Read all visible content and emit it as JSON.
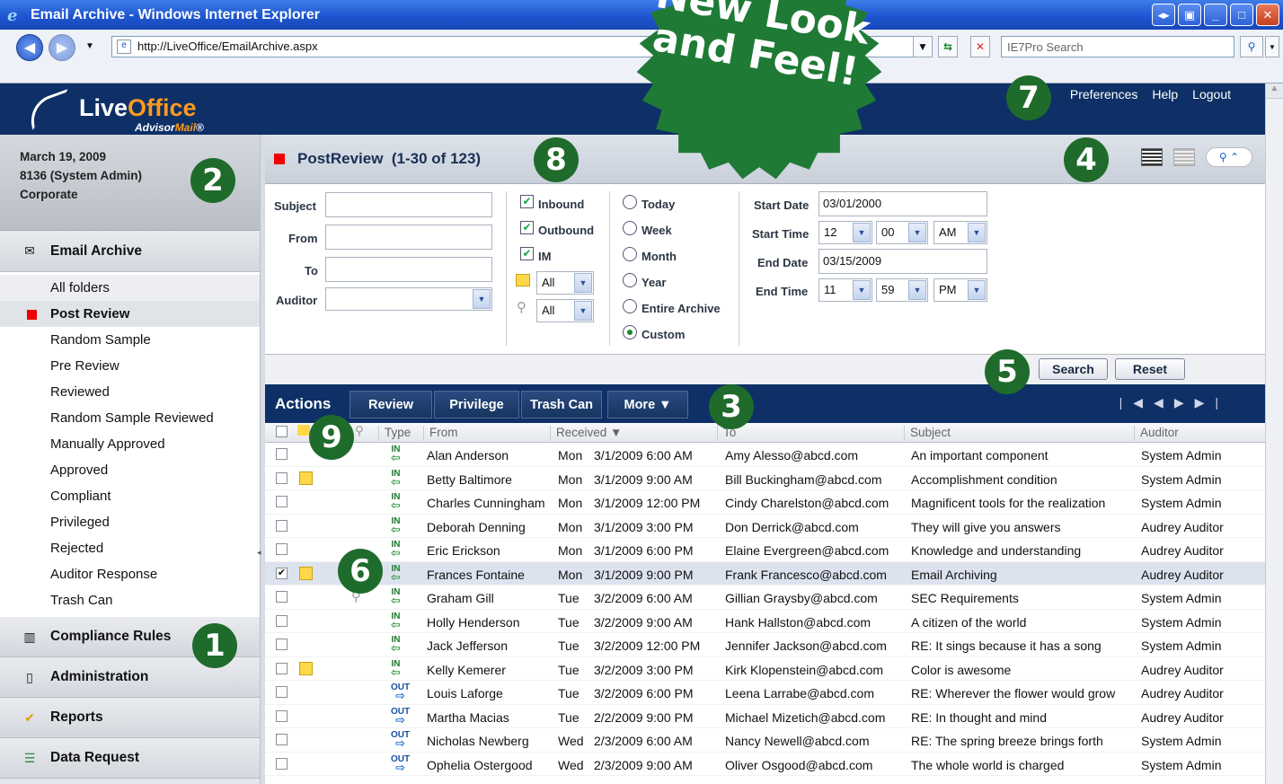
{
  "window": {
    "title": "Email Archive - Windows Internet Explorer"
  },
  "browser": {
    "url": "http://LiveOffice/EmailArchive.aspx",
    "search_placeholder": "IE7Pro Search"
  },
  "brand": {
    "name_a": "Live",
    "name_b": "Office",
    "sub_a": "Advisor",
    "sub_b": "Mail",
    "sub_c": "®"
  },
  "toplinks": [
    "Preferences",
    "Help",
    "Logout"
  ],
  "user": {
    "date": "March 19, 2009",
    "account": "8136 (System Admin)",
    "org": "Corporate"
  },
  "nav": {
    "email_archive": "Email Archive",
    "folders": [
      "All folders",
      "Post Review",
      "Random Sample",
      "Pre Review",
      "Reviewed",
      "Random Sample Reviewed",
      "Manually Approved",
      "Approved",
      "Compliant",
      "Privileged",
      "Rejected",
      "Auditor Response",
      "Trash Can"
    ],
    "bottom": [
      "Compliance Rules",
      "Administration",
      "Reports",
      "Data Request"
    ]
  },
  "page": {
    "title": "PostReview",
    "count": "(1-30 of 123)"
  },
  "filters": {
    "subject_label": "Subject",
    "from_label": "From",
    "to_label": "To",
    "auditor_label": "Auditor",
    "inbound": "Inbound",
    "outbound": "Outbound",
    "im": "IM",
    "flag_all": "All",
    "attach_all": "All",
    "radios": [
      "Today",
      "Week",
      "Month",
      "Year",
      "Entire Archive",
      "Custom"
    ],
    "start_date_label": "Start Date",
    "start_date": "03/01/2000",
    "start_time_label": "Start Time",
    "start_hour": "12",
    "start_min": "00",
    "start_ampm": "AM",
    "end_date_label": "End Date",
    "end_date": "03/15/2009",
    "end_time_label": "End Time",
    "end_hour": "11",
    "end_min": "59",
    "end_ampm": "PM"
  },
  "buttons": {
    "search": "Search",
    "reset": "Reset"
  },
  "actions": {
    "title": "Actions",
    "review": "Review",
    "privilege": "Privilege",
    "trash": "Trash Can",
    "more": "More  ▼"
  },
  "grid": {
    "headers": {
      "type": "Type",
      "from": "From",
      "received": "Received ▼",
      "to": "To",
      "subject": "Subject",
      "auditor": "Auditor"
    },
    "rows": [
      {
        "day": "Mon",
        "date": "3/1/2009 6:00 AM",
        "from": "Alan Anderson",
        "to": "Amy Alesso@abcd.com",
        "subject": "An important component",
        "auditor": "System Admin",
        "dir": "IN"
      },
      {
        "day": "Mon",
        "date": "3/1/2009 9:00 AM",
        "from": "Betty Baltimore",
        "to": "Bill Buckingham@abcd.com",
        "subject": "Accomplishment condition",
        "auditor": "System Admin",
        "dir": "IN"
      },
      {
        "day": "Mon",
        "date": "3/1/2009 12:00 PM",
        "from": "Charles Cunningham",
        "to": "Cindy Charelston@abcd.com",
        "subject": "Magnificent tools for the realization",
        "auditor": "System Admin",
        "dir": "IN"
      },
      {
        "day": "Mon",
        "date": "3/1/2009 3:00 PM",
        "from": "Deborah Denning",
        "to": "Don Derrick@abcd.com",
        "subject": "They will give you answers",
        "auditor": "Audrey Auditor",
        "dir": "IN"
      },
      {
        "day": "Mon",
        "date": "3/1/2009 6:00 PM",
        "from": "Eric Erickson",
        "to": "Elaine Evergreen@abcd.com",
        "subject": "Knowledge and understanding",
        "auditor": "Audrey Auditor",
        "dir": "IN"
      },
      {
        "day": "Mon",
        "date": "3/1/2009 9:00 PM",
        "from": "Frances Fontaine",
        "to": "Frank Francesco@abcd.com",
        "subject": "Email Archiving",
        "auditor": "Audrey Auditor",
        "dir": "IN"
      },
      {
        "day": "Tue",
        "date": "3/2/2009 6:00 AM",
        "from": "Graham Gill",
        "to": "Gillian Graysby@abcd.com",
        "subject": "SEC Requirements",
        "auditor": "System Admin",
        "dir": "IN"
      },
      {
        "day": "Tue",
        "date": "3/2/2009 9:00 AM",
        "from": "Holly Henderson",
        "to": "Hank Hallston@abcd.com",
        "subject": "A citizen of the world",
        "auditor": "System Admin",
        "dir": "IN"
      },
      {
        "day": "Tue",
        "date": "3/2/2009 12:00 PM",
        "from": "Jack Jefferson",
        "to": "Jennifer Jackson@abcd.com",
        "subject": "RE: It sings because it has a song",
        "auditor": "System Admin",
        "dir": "IN"
      },
      {
        "day": "Tue",
        "date": "3/2/2009 3:00 PM",
        "from": "Kelly Kemerer",
        "to": "Kirk Klopenstein@abcd.com",
        "subject": "Color is awesome",
        "auditor": "Audrey Auditor",
        "dir": "IN"
      },
      {
        "day": "Tue",
        "date": "3/2/2009 6:00 PM",
        "from": "Louis Laforge",
        "to": "Leena Larrabe@abcd.com",
        "subject": "RE: Wherever the flower would grow",
        "auditor": "Audrey Auditor",
        "dir": "OUT"
      },
      {
        "day": "Tue",
        "date": "2/2/2009 9:00 PM",
        "from": "Martha Macias",
        "to": "Michael Mizetich@abcd.com",
        "subject": "RE: In thought and mind",
        "auditor": "Audrey Auditor",
        "dir": "OUT"
      },
      {
        "day": "Wed",
        "date": "2/3/2009 6:00 AM",
        "from": "Nicholas Newberg",
        "to": "Nancy Newell@abcd.com",
        "subject": "RE: The spring breeze brings forth",
        "auditor": "System Admin",
        "dir": "OUT"
      },
      {
        "day": "Wed",
        "date": "2/3/2009 9:00 AM",
        "from": "Ophelia Ostergood",
        "to": "Oliver Osgood@abcd.com",
        "subject": "The whole world is charged",
        "auditor": "System Admin",
        "dir": "OUT"
      }
    ]
  },
  "callouts": [
    "1",
    "2",
    "3",
    "4",
    "5",
    "6",
    "7",
    "8",
    "9"
  ],
  "promo": {
    "line1": "New Look",
    "line2": "and Feel!"
  },
  "colors": {
    "header_bg": "#0e3066",
    "badge": "#1f6b2b",
    "accent_red": "#e00000",
    "orange": "#ff9a1f"
  }
}
